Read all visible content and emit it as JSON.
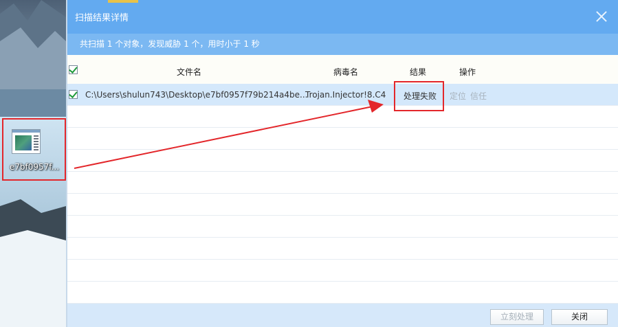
{
  "desktop": {
    "icon_label": "e7bf0957f..."
  },
  "dialog": {
    "title": "扫描结果详情",
    "summary": "共扫描 1 个对象，发现威胁 1 个，用时小于 1 秒",
    "columns": {
      "file_name": "文件名",
      "virus_name": "病毒名",
      "result": "结果",
      "action": "操作"
    },
    "rows": [
      {
        "checked": true,
        "file_path": "C:\\Users\\shulun743\\Desktop\\e7bf0957f79b214a4be...",
        "virus_name": "Trojan.Injector!8.C4",
        "result": "处理失败",
        "action_locate": "定位",
        "action_trust": "信任"
      }
    ],
    "buttons": {
      "handle_now": "立刻处理",
      "close": "关闭"
    }
  },
  "colors": {
    "title_bar": "#63aaf0",
    "summary_bar": "#7bb8f2",
    "selected_row": "#d4e8fb",
    "annotation_red": "#e3262a",
    "footer": "#d6e8fa"
  }
}
